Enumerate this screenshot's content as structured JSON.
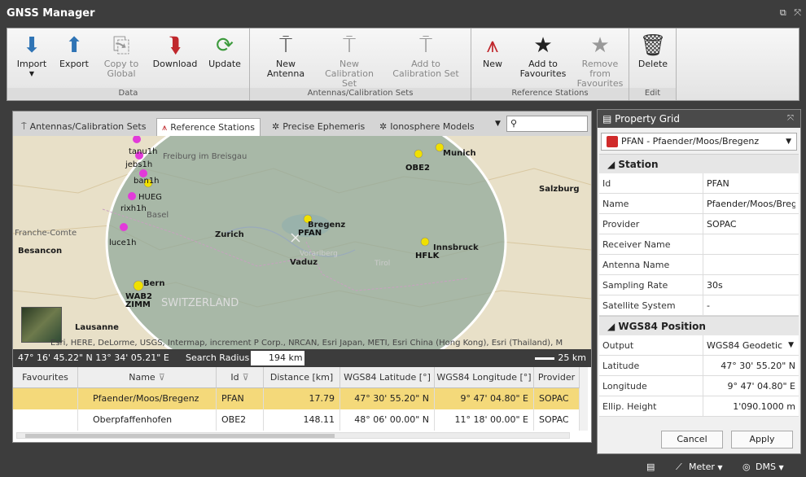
{
  "window": {
    "title": "GNSS Manager",
    "restore_label": "⧉",
    "close_label": "⤧"
  },
  "ribbon": {
    "groups": [
      {
        "label": "Data",
        "buttons": [
          {
            "label": "Import",
            "icon": "import-icon",
            "glyph": "⬇"
          },
          {
            "label": "Export",
            "icon": "export-icon",
            "glyph": "⬆"
          },
          {
            "label": "Copy to Global",
            "icon": "copy-icon",
            "glyph": "⎘"
          },
          {
            "label": "Download",
            "icon": "download-antenna-icon",
            "glyph": "⮯"
          },
          {
            "label": "Update",
            "icon": "update-icon",
            "glyph": "⟳"
          }
        ]
      },
      {
        "label": "Antennas/Calibration Sets",
        "buttons": [
          {
            "label": "New Antenna",
            "icon": "new-antenna-icon",
            "glyph": "⍑"
          },
          {
            "label": "New Calibration Set",
            "icon": "new-calibration-icon",
            "glyph": "⍑"
          },
          {
            "label": "Add to Calibration Set",
            "icon": "add-calibration-icon",
            "glyph": "⍑"
          }
        ]
      },
      {
        "label": "Reference Stations",
        "buttons": [
          {
            "label": "New",
            "icon": "new-station-icon",
            "glyph": "⩚"
          },
          {
            "label": "Add to Favourites",
            "icon": "star-add-icon",
            "glyph": "★"
          },
          {
            "label": "Remove from Favourites",
            "icon": "star-remove-icon",
            "glyph": "★"
          }
        ]
      },
      {
        "label": "Edit",
        "buttons": [
          {
            "label": "Delete",
            "icon": "trash-icon",
            "glyph": "🗑"
          }
        ]
      }
    ]
  },
  "tabs": [
    {
      "label": "Antennas/Calibration Sets",
      "icon": "antenna-icon",
      "glyph": "⍑"
    },
    {
      "label": "Reference Stations",
      "icon": "reference-station-icon",
      "glyph": "⩚"
    },
    {
      "label": "Precise Ephemeris",
      "icon": "satellite-icon",
      "glyph": "✲"
    },
    {
      "label": "Ionosphere Models",
      "icon": "satellite-icon",
      "glyph": "✲"
    }
  ],
  "map": {
    "search_icon": "search-icon",
    "places": [
      {
        "name": "Freiburg im Breisgau"
      },
      {
        "name": "Basel"
      },
      {
        "name": "Zurich"
      },
      {
        "name": "Besancon"
      },
      {
        "name": "Vaduz"
      },
      {
        "name": "Salzburg"
      },
      {
        "name": "Munich"
      },
      {
        "name": "Innsbruck"
      },
      {
        "name": "Bern"
      },
      {
        "name": "SWITZERLAND"
      },
      {
        "name": "Lausanne"
      },
      {
        "name": "Franche-Comte"
      },
      {
        "name": "Bregenz"
      },
      {
        "name": "Vorarlberg"
      },
      {
        "name": "Tirol"
      }
    ],
    "stations": [
      "tanu1h",
      "jebs1h",
      "ban1h",
      "HUEG",
      "rixh1h",
      "luce1h",
      "PFAN",
      "OBE2",
      "HFLK",
      "WAB2",
      "ZIMM"
    ],
    "attribution": "Esri, HERE, DeLorme, USGS, Intermap, increment P Corp., NRCAN, Esri Japan, METI, Esri China (Hong Kong), Esri (Thailand), M"
  },
  "coordbar": {
    "position": "47° 16' 45.22\" N   13° 34' 05.21\" E",
    "search_radius_label": "Search Radius",
    "search_radius_value": "194 km",
    "scale_label": "25 km"
  },
  "grid": {
    "headers": [
      "Favourites",
      "Name",
      "Id",
      "Distance [km]",
      "WGS84 Latitude [°]",
      "WGS84 Longitude [°]",
      "Provider"
    ],
    "rows": [
      {
        "favourite": "",
        "name": "Pfaender/Moos/Bregenz",
        "id": "PFAN",
        "distance": "17.79",
        "lat": "47° 30' 55.20\" N",
        "lon": "9° 47' 04.80\" E",
        "provider": "SOPAC",
        "selected": true
      },
      {
        "favourite": "",
        "name": "Oberpfaffenhofen",
        "id": "OBE2",
        "distance": "148.11",
        "lat": "48° 06' 00.00\" N",
        "lon": "11° 18' 00.00\" E",
        "provider": "SOPAC",
        "selected": false
      }
    ]
  },
  "property_grid": {
    "title": "Property Grid",
    "selection": "PFAN - Pfaender/Moos/Bregenz",
    "categories": [
      {
        "label": "Station",
        "rows": [
          {
            "key": "Id",
            "value": "PFAN"
          },
          {
            "key": "Name",
            "value": "Pfaender/Moos/Bregenz"
          },
          {
            "key": "Provider",
            "value": "SOPAC"
          },
          {
            "key": "Receiver Name",
            "value": ""
          },
          {
            "key": "Antenna Name",
            "value": ""
          },
          {
            "key": "Sampling Rate",
            "value": "30s"
          },
          {
            "key": "Satellite System",
            "value": "-"
          }
        ]
      },
      {
        "label": "WGS84 Position",
        "rows": [
          {
            "key": "Output",
            "value": "WGS84 Geodetic"
          },
          {
            "key": "Latitude",
            "value": "47° 30' 55.20\" N"
          },
          {
            "key": "Longitude",
            "value": "9° 47' 04.80\" E"
          },
          {
            "key": "Ellip. Height",
            "value": "1'090.1000 m"
          }
        ]
      }
    ],
    "cancel_label": "Cancel",
    "apply_label": "Apply"
  },
  "statusbar": {
    "units_label": "Meter",
    "angle_label": "DMS"
  },
  "colors": {
    "chrome": "#3d3d3d",
    "selected_row": "#f4d97a",
    "station_yellow": "#f0e000",
    "station_magenta": "#e23ad9"
  }
}
